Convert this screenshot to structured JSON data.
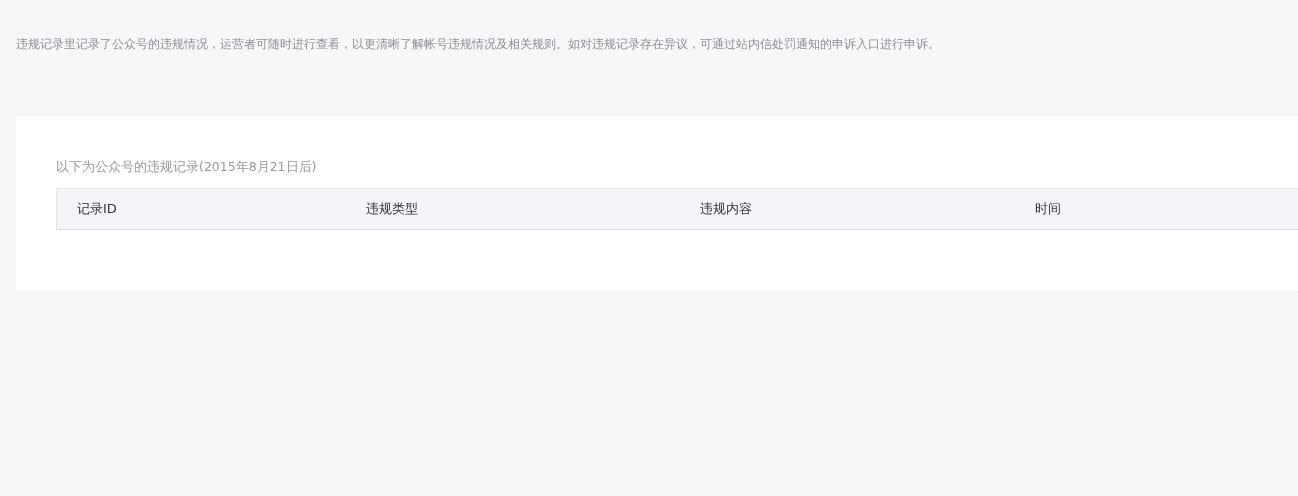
{
  "notice": "违规记录里记录了公众号的违规情况，运营者可随时进行查看，以更清晰了解帐号违规情况及相关规则。如对违规记录存在异议，可通过站内信处罚通知的申诉入口进行申诉。",
  "records": {
    "caption": "以下为公众号的违规记录(2015年8月21日后)",
    "columns": [
      "记录ID",
      "违规类型",
      "违规内容",
      "时间"
    ]
  }
}
